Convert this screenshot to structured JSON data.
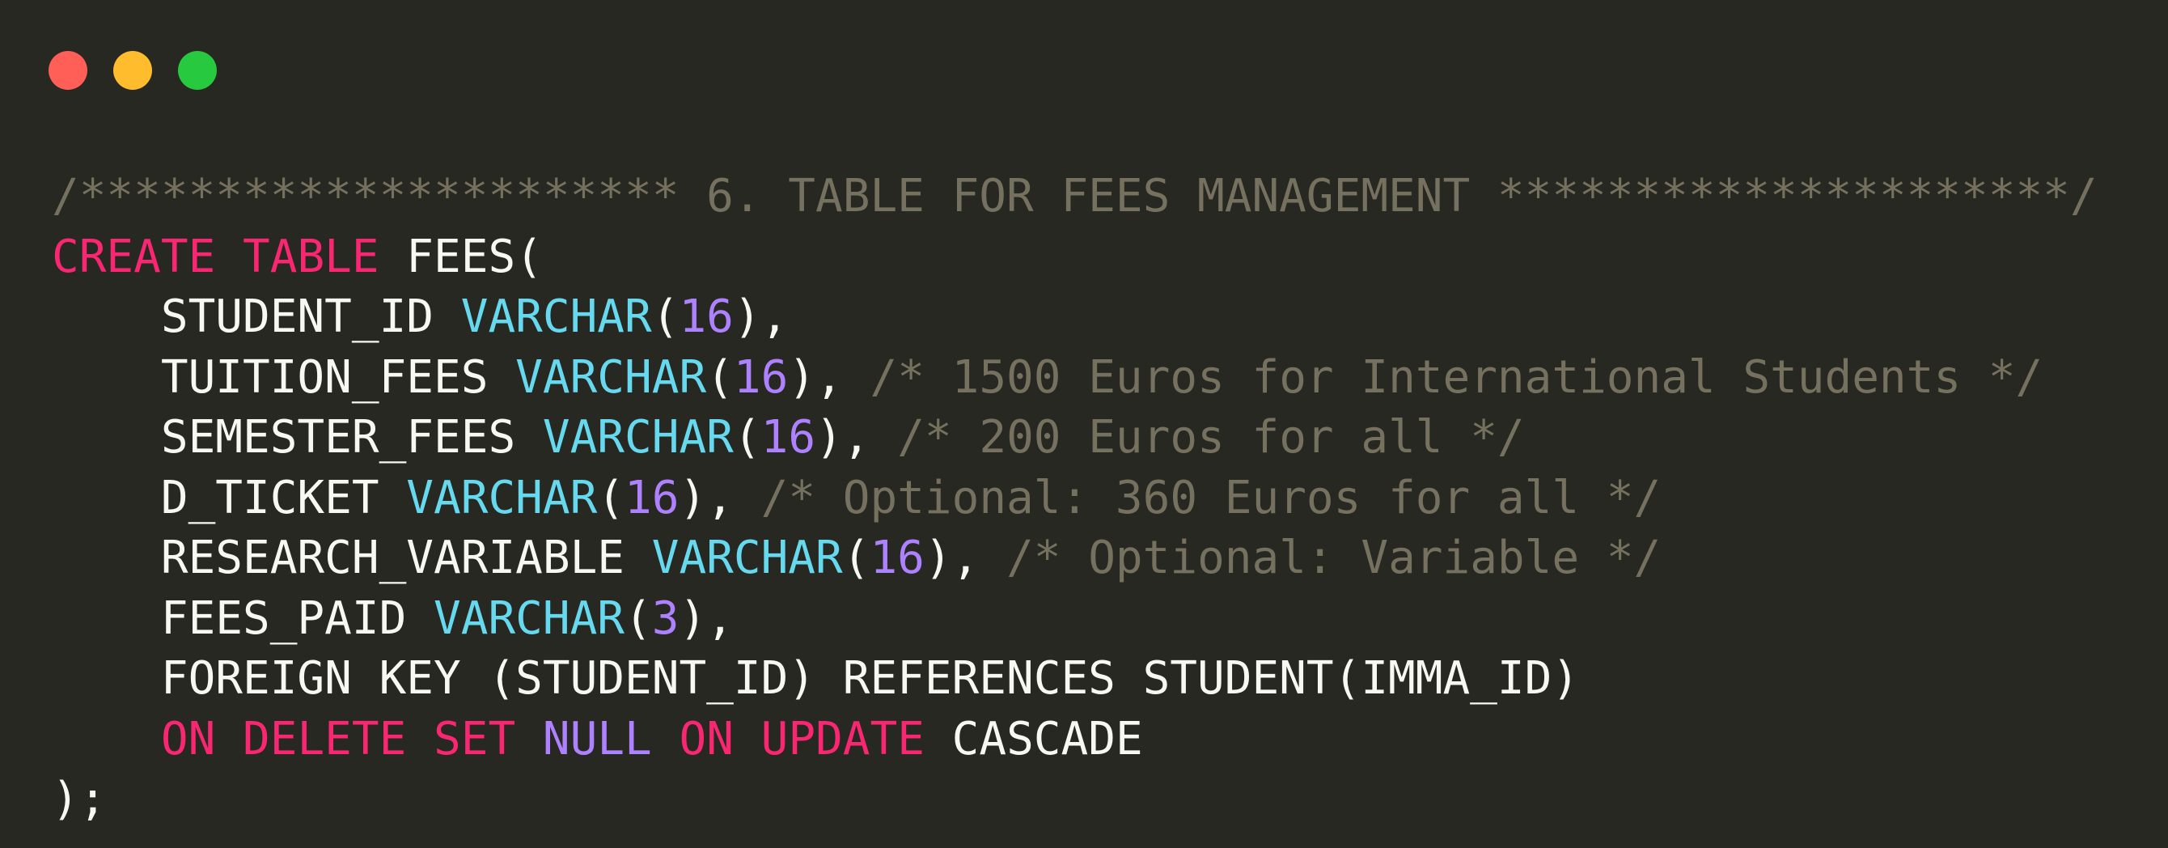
{
  "window": {
    "controls": {
      "close_color": "#ff5f56",
      "minimize_color": "#ffbd2e",
      "maximize_color": "#27c93f"
    }
  },
  "colors": {
    "background": "#272822",
    "plain": "#f8f8f2",
    "comment": "#75715e",
    "keyword": "#f92672",
    "type": "#66d9ef",
    "number": "#ae81ff"
  },
  "code": {
    "lines": [
      [
        {
          "t": "c",
          "text": "/********************** 6. TABLE FOR FEES MANAGEMENT *********************/"
        }
      ],
      [
        {
          "t": "k",
          "text": "CREATE"
        },
        {
          "t": "p",
          "text": " "
        },
        {
          "t": "k",
          "text": "TABLE"
        },
        {
          "t": "p",
          "text": " FEES("
        }
      ],
      [
        {
          "t": "p",
          "text": "    STUDENT_ID "
        },
        {
          "t": "t",
          "text": "VARCHAR"
        },
        {
          "t": "p",
          "text": "("
        },
        {
          "t": "n",
          "text": "16"
        },
        {
          "t": "p",
          "text": "),"
        }
      ],
      [
        {
          "t": "p",
          "text": "    TUITION_FEES "
        },
        {
          "t": "t",
          "text": "VARCHAR"
        },
        {
          "t": "p",
          "text": "("
        },
        {
          "t": "n",
          "text": "16"
        },
        {
          "t": "p",
          "text": "), "
        },
        {
          "t": "c",
          "text": "/* 1500 Euros for International Students */"
        }
      ],
      [
        {
          "t": "p",
          "text": "    SEMESTER_FEES "
        },
        {
          "t": "t",
          "text": "VARCHAR"
        },
        {
          "t": "p",
          "text": "("
        },
        {
          "t": "n",
          "text": "16"
        },
        {
          "t": "p",
          "text": "), "
        },
        {
          "t": "c",
          "text": "/* 200 Euros for all */"
        }
      ],
      [
        {
          "t": "p",
          "text": "    D_TICKET "
        },
        {
          "t": "t",
          "text": "VARCHAR"
        },
        {
          "t": "p",
          "text": "("
        },
        {
          "t": "n",
          "text": "16"
        },
        {
          "t": "p",
          "text": "), "
        },
        {
          "t": "c",
          "text": "/* Optional: 360 Euros for all */"
        }
      ],
      [
        {
          "t": "p",
          "text": "    RESEARCH_VARIABLE "
        },
        {
          "t": "t",
          "text": "VARCHAR"
        },
        {
          "t": "p",
          "text": "("
        },
        {
          "t": "n",
          "text": "16"
        },
        {
          "t": "p",
          "text": "), "
        },
        {
          "t": "c",
          "text": "/* Optional: Variable */"
        }
      ],
      [
        {
          "t": "p",
          "text": "    FEES_PAID "
        },
        {
          "t": "t",
          "text": "VARCHAR"
        },
        {
          "t": "p",
          "text": "("
        },
        {
          "t": "n",
          "text": "3"
        },
        {
          "t": "p",
          "text": "),"
        }
      ],
      [
        {
          "t": "p",
          "text": "    FOREIGN KEY (STUDENT_ID) REFERENCES STUDENT(IMMA_ID)"
        }
      ],
      [
        {
          "t": "p",
          "text": "    "
        },
        {
          "t": "k",
          "text": "ON"
        },
        {
          "t": "p",
          "text": " "
        },
        {
          "t": "k",
          "text": "DELETE"
        },
        {
          "t": "p",
          "text": " "
        },
        {
          "t": "k",
          "text": "SET"
        },
        {
          "t": "p",
          "text": " "
        },
        {
          "t": "n",
          "text": "NULL"
        },
        {
          "t": "p",
          "text": " "
        },
        {
          "t": "k",
          "text": "ON"
        },
        {
          "t": "p",
          "text": " "
        },
        {
          "t": "k",
          "text": "UPDATE"
        },
        {
          "t": "p",
          "text": " CASCADE"
        }
      ],
      [
        {
          "t": "p",
          "text": ");"
        }
      ]
    ]
  }
}
